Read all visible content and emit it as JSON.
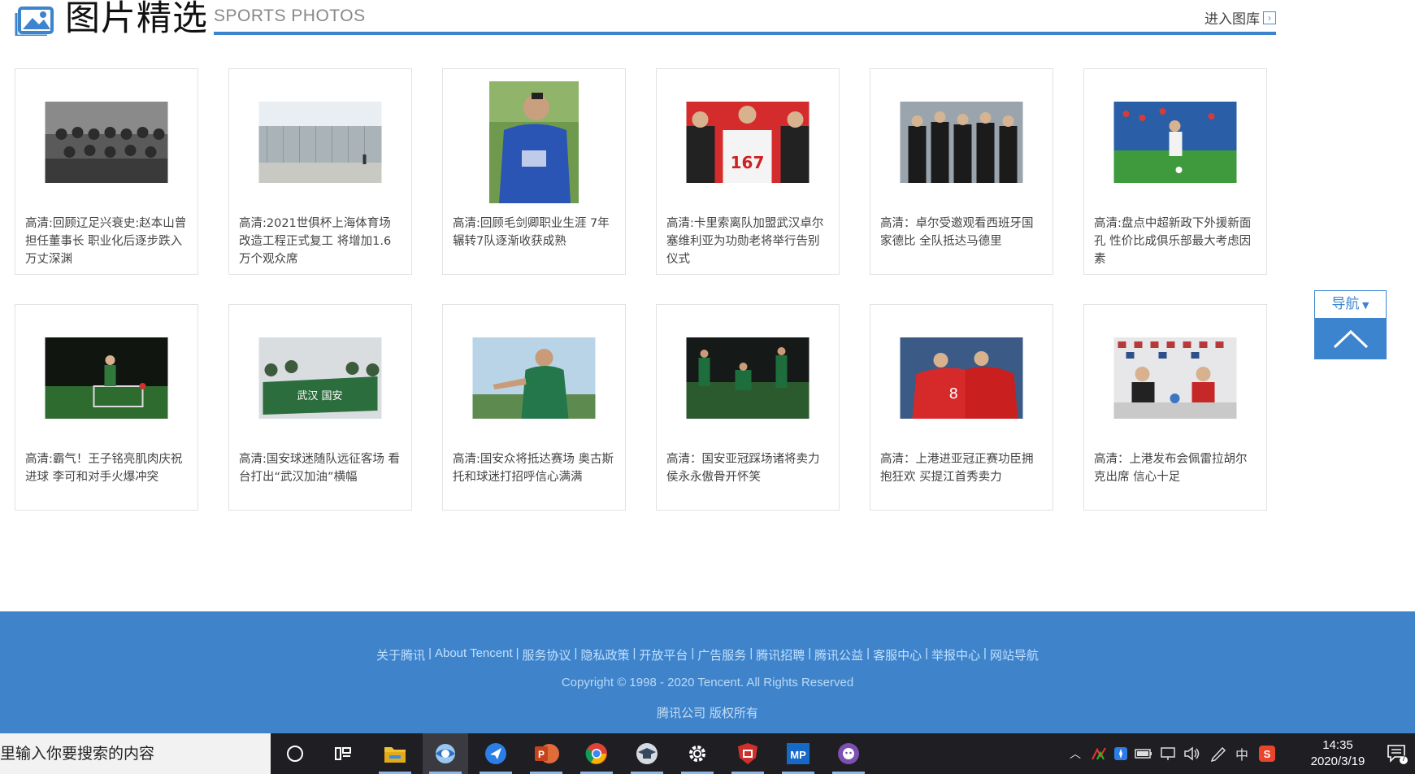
{
  "header": {
    "title": "图片精选",
    "subtitle": "SPORTS PHOTOS",
    "gallery_link": "进入图库",
    "accent_color": "#3d84cf"
  },
  "cards": [
    {
      "caption": "高清:回顾辽足兴衰史:赵本山曾担任董事长 职业化后逐步跌入万丈深渊",
      "thumb": "bw-team-photo"
    },
    {
      "caption": "高清:2021世俱杯上海体育场改造工程正式复工 将增加1.6万个观众席",
      "thumb": "stadium-construction"
    },
    {
      "caption": "高清:回顾毛剑卿职业生涯 7年辗转7队逐渐收获成熟",
      "thumb": "player-blue-jersey"
    },
    {
      "caption": "高清:卡里索离队加盟武汉卓尔 塞维利亚为功勋老将举行告别仪式",
      "thumb": "jersey-167-ceremony"
    },
    {
      "caption": "高清：卓尔受邀观看西班牙国家德比 全队抵达马德里",
      "thumb": "team-arrival"
    },
    {
      "caption": "高清:盘点中超新政下外援新面孔 性价比成俱乐部最大考虑因素",
      "thumb": "player-stadium-pitch"
    },
    {
      "caption": "高清:霸气！王子铭亮肌肉庆祝进球 李可和对手火爆冲突",
      "thumb": "night-match"
    },
    {
      "caption": "高清:国安球迷随队远征客场 看台打出“武汉加油”横幅",
      "thumb": "fans-banner"
    },
    {
      "caption": "高清:国安众将抵达赛场 奥古斯托和球迷打招呼信心满满",
      "thumb": "player-green-jersey"
    },
    {
      "caption": "高清：国安亚冠踩场诸将卖力 侯永永傲骨开怀笑",
      "thumb": "training-session"
    },
    {
      "caption": "高清：上港进亚冠正赛功臣拥抱狂欢 买提江首秀卖力",
      "thumb": "red-team-celebration"
    },
    {
      "caption": "高清：上港发布会佩雷拉胡尔克出席 信心十足",
      "thumb": "press-conference"
    }
  ],
  "side_nav": {
    "nav_label": "导航",
    "back_to_top": "chevron-up-icon"
  },
  "footer": {
    "links": [
      "关于腾讯",
      "About Tencent",
      "服务协议",
      "隐私政策",
      "开放平台",
      "广告服务",
      "腾讯招聘",
      "腾讯公益",
      "客服中心",
      "举报中心",
      "网站导航"
    ],
    "copyright": "Copyright © 1998 - 2020 Tencent. All Rights Reserved",
    "company": "腾讯公司 版权所有",
    "bg_color": "#3f84cb"
  },
  "taskbar": {
    "search_placeholder": "里输入你要搜索的内容",
    "apps": [
      "cortana-icon",
      "task-view-icon",
      "file-explorer-icon",
      "browser-icon",
      "feishu-icon",
      "powerpoint-icon",
      "chrome-icon",
      "education-icon",
      "settings-icon",
      "security-icon",
      "mp-icon",
      "github-icon"
    ],
    "ime": "中",
    "time": "14:35",
    "date": "2020/3/19",
    "notification_count": "7"
  }
}
